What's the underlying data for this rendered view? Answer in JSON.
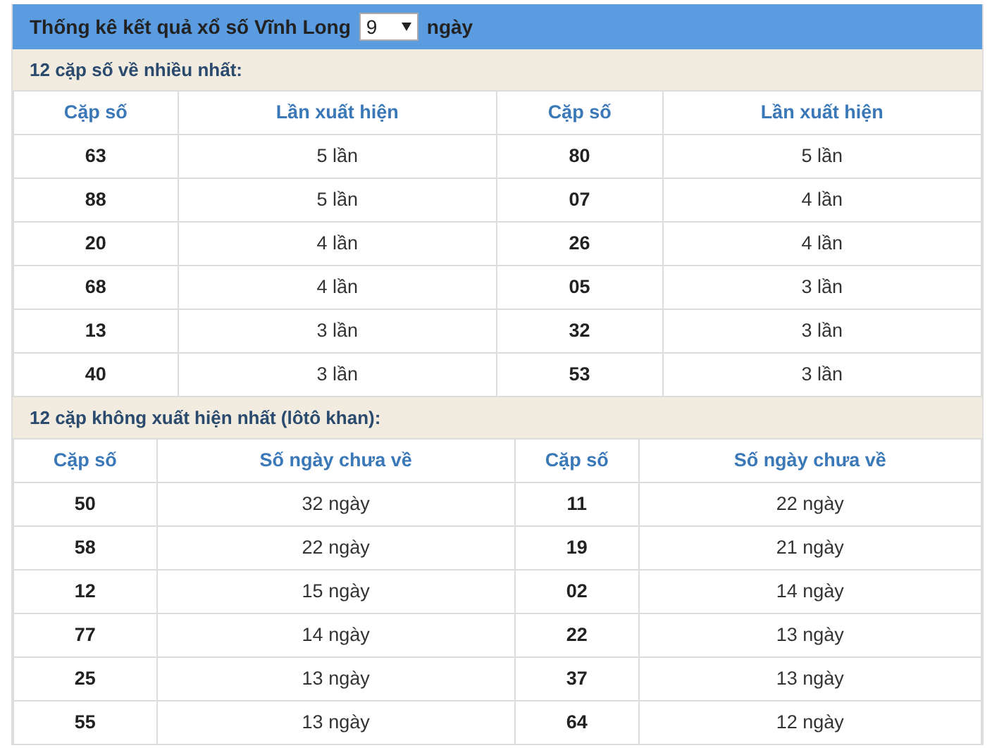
{
  "header": {
    "title": "Thống kê kết quả xổ số Vĩnh Long",
    "days_select": "9",
    "suffix": "ngày"
  },
  "sections": [
    {
      "heading": "12 cặp số về nhiều nhất:",
      "columns": [
        "Cặp số",
        "Lần xuất hiện",
        "Cặp số",
        "Lần xuất hiện"
      ],
      "rows": [
        [
          "63",
          "5 lần",
          "80",
          "5 lần"
        ],
        [
          "88",
          "5 lần",
          "07",
          "4 lần"
        ],
        [
          "20",
          "4 lần",
          "26",
          "4 lần"
        ],
        [
          "68",
          "4 lần",
          "05",
          "3 lần"
        ],
        [
          "13",
          "3 lần",
          "32",
          "3 lần"
        ],
        [
          "40",
          "3 lần",
          "53",
          "3 lần"
        ]
      ]
    },
    {
      "heading": "12 cặp không xuất hiện nhất (lôtô khan):",
      "columns": [
        "Cặp số",
        "Số ngày chưa về",
        "Cặp số",
        "Số ngày chưa về"
      ],
      "rows": [
        [
          "50",
          "32 ngày",
          "11",
          "22 ngày"
        ],
        [
          "58",
          "22 ngày",
          "19",
          "21 ngày"
        ],
        [
          "12",
          "15 ngày",
          "02",
          "14 ngày"
        ],
        [
          "77",
          "14 ngày",
          "22",
          "13 ngày"
        ],
        [
          "25",
          "13 ngày",
          "37",
          "13 ngày"
        ],
        [
          "55",
          "13 ngày",
          "64",
          "12 ngày"
        ]
      ]
    }
  ]
}
